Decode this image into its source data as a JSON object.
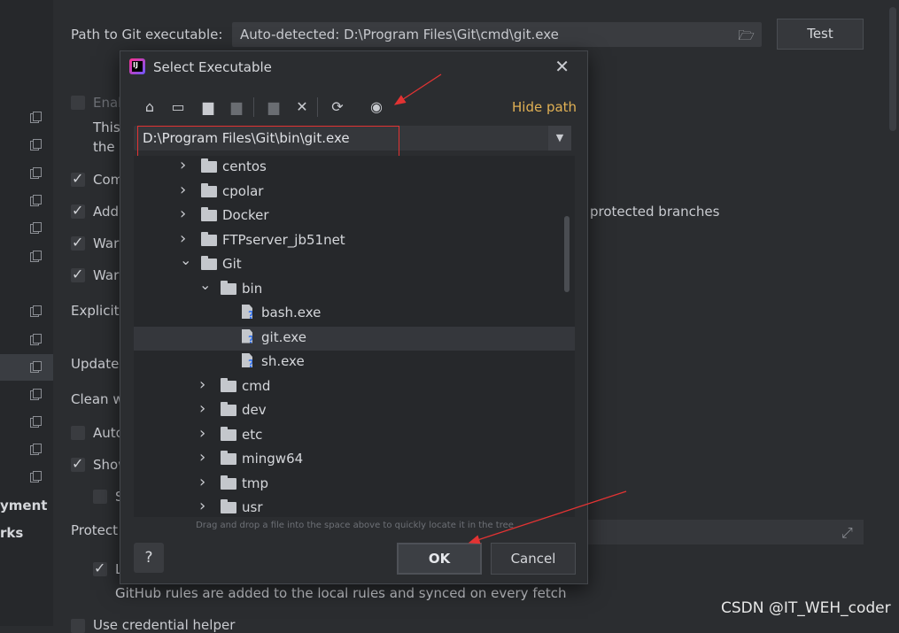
{
  "settings": {
    "path_label": "Path to Git executable:",
    "path_value": "Auto-detected: D:\\Program Files\\Git\\cmd\\git.exe",
    "test_button": "Test",
    "enable_text": "Enab",
    "this_text": "This",
    "the_text": "the p",
    "com_text": "Com",
    "add_text": "Add",
    "protected_text": "protected branches",
    "war1_text": "War",
    "war2_text": "War",
    "explicit_text": "Explicitl",
    "update_text": "Update",
    "clean_text": "Clean w",
    "auto_text": "Auto",
    "show_text": "Show",
    "s_text": "S",
    "protect_text": "Protect",
    "l_text": "L",
    "github_rules_text": "GitHub rules are added to the local rules and synced on every fetch",
    "credential_text": "Use credential helper"
  },
  "sidebar": {
    "deployment_text": "yment",
    "works_text": "rks"
  },
  "dialog": {
    "title": "Select Executable",
    "hide_path": "Hide path",
    "path": "D:\\Program Files\\Git\\bin\\git.exe",
    "hint": "Drag and drop a file into the space above to quickly locate it in the tree",
    "help": "?",
    "ok": "OK",
    "cancel": "Cancel",
    "tree": [
      {
        "name": "centos",
        "type": "folder",
        "expanded": false,
        "level": 0
      },
      {
        "name": "cpolar",
        "type": "folder",
        "expanded": false,
        "level": 0
      },
      {
        "name": "Docker",
        "type": "folder",
        "expanded": false,
        "level": 0
      },
      {
        "name": "FTPserver_jb51net",
        "type": "folder",
        "expanded": false,
        "level": 0
      },
      {
        "name": "Git",
        "type": "folder",
        "expanded": true,
        "level": 0
      },
      {
        "name": "bin",
        "type": "folder",
        "expanded": true,
        "level": 1
      },
      {
        "name": "bash.exe",
        "type": "file",
        "level": 2
      },
      {
        "name": "git.exe",
        "type": "file",
        "level": 2,
        "selected": true
      },
      {
        "name": "sh.exe",
        "type": "file",
        "level": 2
      },
      {
        "name": "cmd",
        "type": "folder",
        "expanded": false,
        "level": 1
      },
      {
        "name": "dev",
        "type": "folder",
        "expanded": false,
        "level": 1
      },
      {
        "name": "etc",
        "type": "folder",
        "expanded": false,
        "level": 1
      },
      {
        "name": "mingw64",
        "type": "folder",
        "expanded": false,
        "level": 1
      },
      {
        "name": "tmp",
        "type": "folder",
        "expanded": false,
        "level": 1
      },
      {
        "name": "usr",
        "type": "folder",
        "expanded": false,
        "level": 1
      }
    ]
  },
  "watermark": "CSDN @IT_WEH_coder",
  "colors": {
    "accent": "#e0b054",
    "annotation": "#e23333",
    "background": "#2b2d30"
  }
}
